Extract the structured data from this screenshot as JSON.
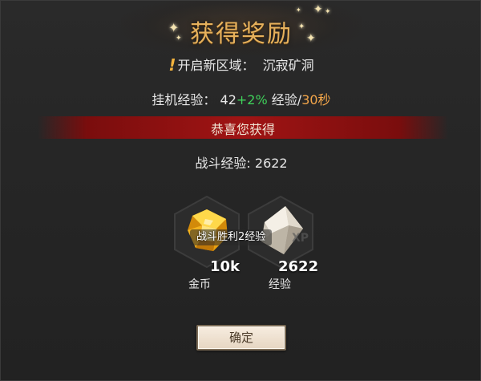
{
  "dialog": {
    "title": "获得奖励",
    "new_region": {
      "prefix": "!",
      "label": "开启新区域：",
      "value": "沉寂矿洞"
    },
    "idle_exp": {
      "label": "挂机经验：",
      "base": "42",
      "bonus": "+2%",
      "unit_text": "经验/",
      "interval": "30秒"
    },
    "banner_text": "恭喜您获得",
    "battle_exp": {
      "label": "战斗经验:",
      "value": "2622"
    },
    "rewards": [
      {
        "icon": "gold-gem-icon",
        "amount": "10k",
        "name": "金币",
        "color": "#f2b21e"
      },
      {
        "icon": "exp-gem-icon",
        "amount": "2622",
        "name": "经验",
        "color": "#e8e2d6",
        "watermark": "XP"
      }
    ],
    "tooltip": "战斗胜利2经验",
    "confirm_label": "确定"
  },
  "colors": {
    "title": "#e6b15c",
    "bonus_green": "#3fd15a",
    "accent_orange": "#f3a64a",
    "banner_red": "#a01414",
    "exclamation": "#f3b33d"
  }
}
